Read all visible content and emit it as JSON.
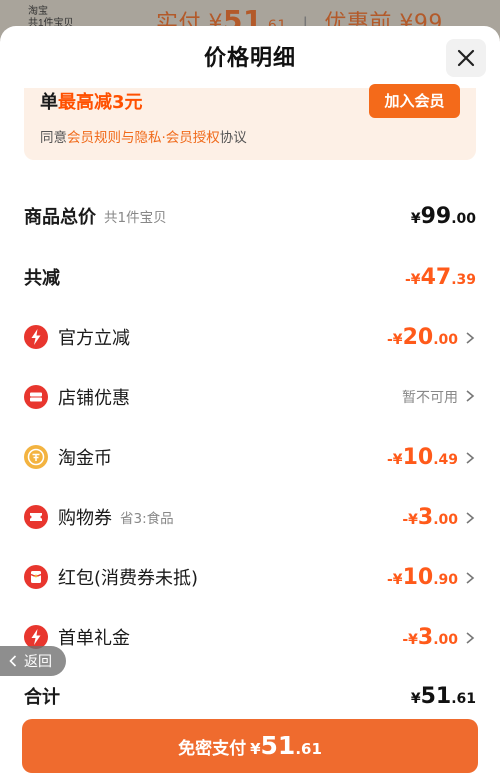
{
  "background": {
    "logo_line1": "淘宝",
    "logo_line2": "共1件宝贝",
    "pay_prefix": "实付",
    "pay_currency": "¥",
    "pay_int": "51",
    "pay_dec": ".61",
    "discount_prefix": "优惠前",
    "discount_value": "¥99"
  },
  "sheet": {
    "title": "价格明细",
    "close_icon": "close-icon"
  },
  "promo": {
    "text_prefix": "单",
    "text_highlight": "最高减3元",
    "join_label": "加入会员",
    "agree_prefix": "同意",
    "agree_link": "会员规则与隐私·会员授权",
    "agree_suffix": "协议"
  },
  "rows": {
    "goods_total": {
      "label": "商品总价",
      "sub": "共1件宝贝",
      "cur": "¥",
      "int": "99",
      "dec": ".00"
    },
    "total_reduce": {
      "label": "共减",
      "cur": "-¥",
      "int": "47",
      "dec": ".39"
    },
    "official": {
      "icon": "lightning-icon",
      "label": "官方立减",
      "cur": "-¥",
      "int": "20",
      "dec": ".00"
    },
    "shop": {
      "icon": "shop-coupon-icon",
      "label": "店铺优惠",
      "status": "暂不可用"
    },
    "coin": {
      "icon": "coin-icon",
      "label": "淘金币",
      "cur": "-¥",
      "int": "10",
      "dec": ".49"
    },
    "voucher": {
      "icon": "ticket-icon",
      "label": "购物券",
      "sub": "省3:食品",
      "cur": "-¥",
      "int": "3",
      "dec": ".00"
    },
    "redpacket": {
      "icon": "red-packet-icon",
      "label": "红包(消费券未抵)",
      "cur": "-¥",
      "int": "10",
      "dec": ".90"
    },
    "first_order": {
      "icon": "lightning-icon",
      "label": "首单礼金",
      "cur": "-¥",
      "int": "3",
      "dec": ".00"
    },
    "sum": {
      "label": "合计",
      "cur": "¥",
      "int": "51",
      "dec": ".61"
    }
  },
  "pay_button": {
    "label": "免密支付",
    "cur": "¥",
    "int": "51",
    "dec": ".61"
  },
  "back": {
    "label": "返回"
  },
  "colors": {
    "accent": "#ff5a1a",
    "button": "#ef6b2e",
    "promo_bg": "#fdf0e6",
    "icon_red": "#e8362e",
    "icon_gold": "#f3b340"
  }
}
